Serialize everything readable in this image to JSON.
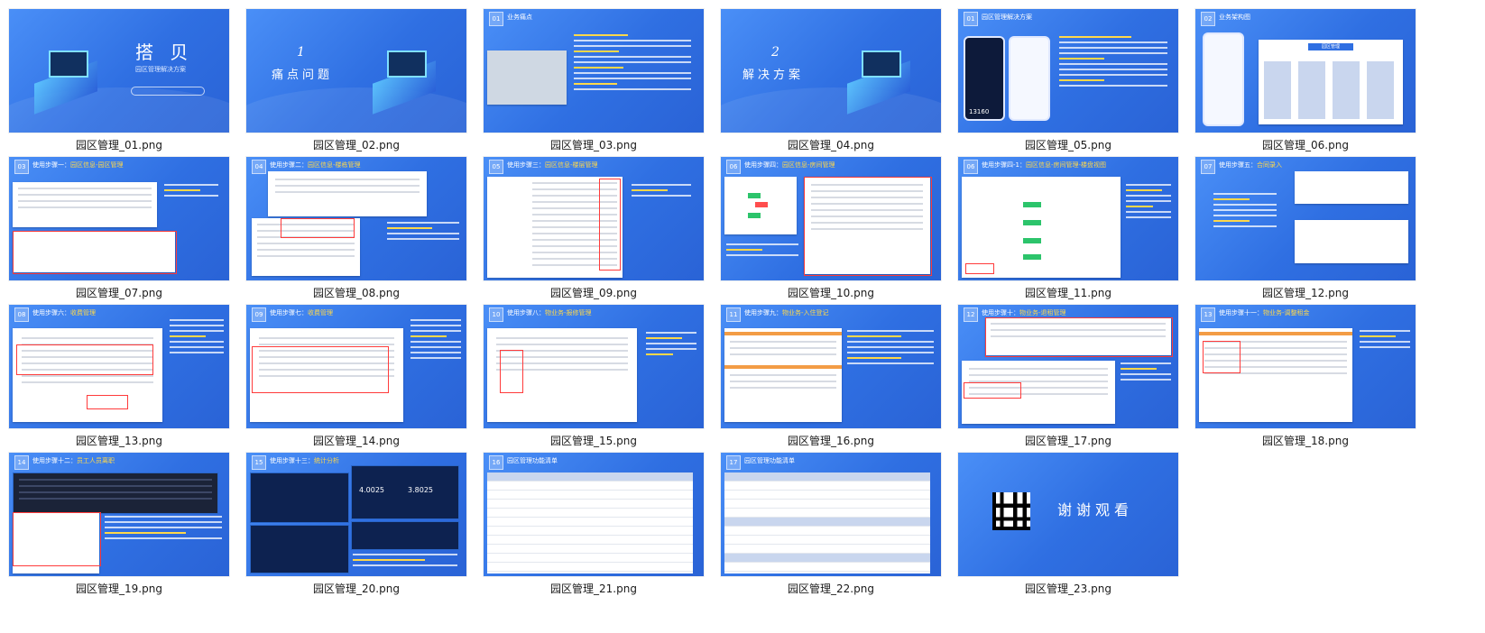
{
  "files": [
    {
      "label": "园区管理_01.png"
    },
    {
      "label": "园区管理_02.png"
    },
    {
      "label": "园区管理_03.png"
    },
    {
      "label": "园区管理_04.png"
    },
    {
      "label": "园区管理_05.png"
    },
    {
      "label": "园区管理_06.png"
    },
    {
      "label": "园区管理_07.png"
    },
    {
      "label": "园区管理_08.png"
    },
    {
      "label": "园区管理_09.png"
    },
    {
      "label": "园区管理_10.png"
    },
    {
      "label": "园区管理_11.png"
    },
    {
      "label": "园区管理_12.png"
    },
    {
      "label": "园区管理_13.png"
    },
    {
      "label": "园区管理_14.png"
    },
    {
      "label": "园区管理_15.png"
    },
    {
      "label": "园区管理_16.png"
    },
    {
      "label": "园区管理_17.png"
    },
    {
      "label": "园区管理_18.png"
    },
    {
      "label": "园区管理_19.png"
    },
    {
      "label": "园区管理_20.png"
    },
    {
      "label": "园区管理_21.png"
    },
    {
      "label": "园区管理_22.png"
    },
    {
      "label": "园区管理_23.png"
    }
  ],
  "slides": {
    "s01": {
      "title": "搭 贝",
      "subtitle": "园区管理解决方案"
    },
    "s02": {
      "num": "1",
      "title": "痛点问题"
    },
    "s03": {
      "num": "01",
      "head": "业务痛点"
    },
    "s04": {
      "num": "2",
      "title": "解决方案"
    },
    "s05": {
      "num": "01",
      "head": "园区管理解决方案",
      "counter": "13160"
    },
    "s06": {
      "num": "02",
      "head": "业务架构图",
      "box": "园区管理"
    },
    "s07": {
      "num": "03",
      "head": "使用步骤一：",
      "hl": "园区信息-园区管理"
    },
    "s08": {
      "num": "04",
      "head": "使用步骤二：",
      "hl": "园区信息-楼栋管理"
    },
    "s09": {
      "num": "05",
      "head": "使用步骤三：",
      "hl": "园区信息-楼层管理"
    },
    "s10": {
      "num": "06",
      "head": "使用步骤四：",
      "hl": "园区信息-房间管理"
    },
    "s11": {
      "num": "06",
      "head": "使用步骤四-1：",
      "hl": "园区信息-房间管理-楼盘视图"
    },
    "s12": {
      "num": "07",
      "head": "使用步骤五：",
      "hl": "合同录入"
    },
    "s13": {
      "num": "08",
      "head": "使用步骤六：",
      "hl": "收费管理"
    },
    "s14": {
      "num": "09",
      "head": "使用步骤七：",
      "hl": "收费管理"
    },
    "s15": {
      "num": "10",
      "head": "使用步骤八：",
      "hl": "物业务-报修管理"
    },
    "s16": {
      "num": "11",
      "head": "使用步骤九：",
      "hl": "物业务-入住登记"
    },
    "s17": {
      "num": "12",
      "head": "使用步骤十：",
      "hl": "物业务-退租管理"
    },
    "s18": {
      "num": "13",
      "head": "使用步骤十一：",
      "hl": "物业务-调整租金"
    },
    "s19": {
      "num": "14",
      "head": "使用步骤十二：",
      "hl": "员工人员离职"
    },
    "s20": {
      "num": "15",
      "head": "使用步骤十三：",
      "hl": "统计分析",
      "stat1": "4.0025",
      "stat2": "3.8025"
    },
    "s21": {
      "num": "16",
      "head": "园区管理功能清单"
    },
    "s22": {
      "num": "17",
      "head": "园区管理功能清单"
    },
    "s23": {
      "title": "谢谢观看"
    }
  }
}
